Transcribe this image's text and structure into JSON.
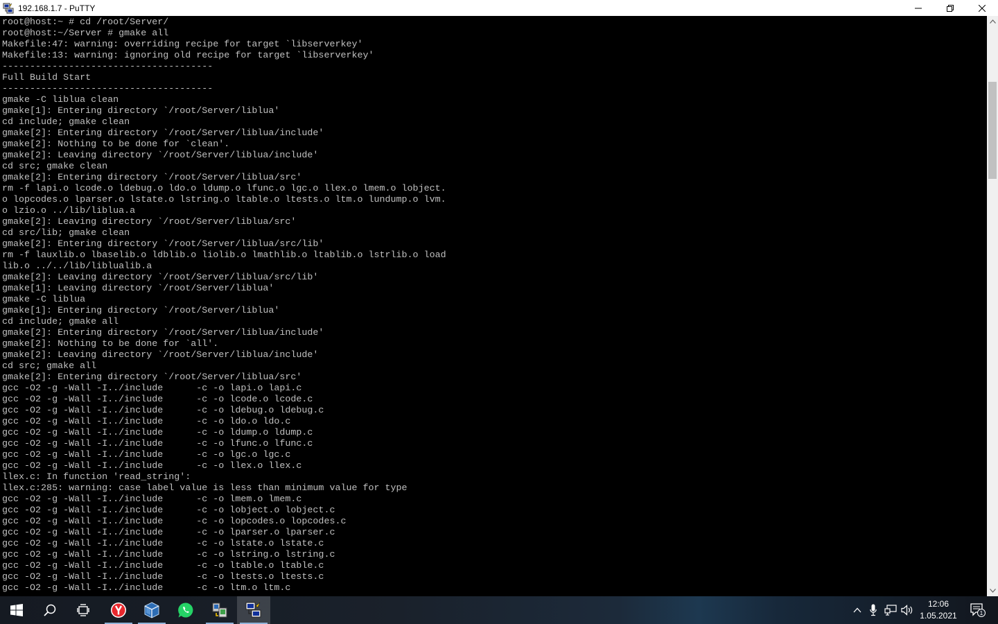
{
  "window": {
    "title": "192.168.1.7 - PuTTY",
    "controls": [
      "minimize-icon",
      "restore-icon",
      "close-icon"
    ]
  },
  "terminal": {
    "lines": [
      "root@host:~ # cd /root/Server/",
      "root@host:~/Server # gmake all",
      "Makefile:47: warning: overriding recipe for target `libserverkey'",
      "Makefile:13: warning: ignoring old recipe for target `libserverkey'",
      "--------------------------------------",
      "Full Build Start",
      "--------------------------------------",
      "gmake -C liblua clean",
      "gmake[1]: Entering directory `/root/Server/liblua'",
      "cd include; gmake clean",
      "gmake[2]: Entering directory `/root/Server/liblua/include'",
      "gmake[2]: Nothing to be done for `clean'.",
      "gmake[2]: Leaving directory `/root/Server/liblua/include'",
      "cd src; gmake clean",
      "gmake[2]: Entering directory `/root/Server/liblua/src'",
      "rm -f lapi.o lcode.o ldebug.o ldo.o ldump.o lfunc.o lgc.o llex.o lmem.o lobject.",
      "o lopcodes.o lparser.o lstate.o lstring.o ltable.o ltests.o ltm.o lundump.o lvm.",
      "o lzio.o ../lib/liblua.a",
      "gmake[2]: Leaving directory `/root/Server/liblua/src'",
      "cd src/lib; gmake clean",
      "gmake[2]: Entering directory `/root/Server/liblua/src/lib'",
      "rm -f lauxlib.o lbaselib.o ldblib.o liolib.o lmathlib.o ltablib.o lstrlib.o load",
      "lib.o ../../lib/liblualib.a",
      "gmake[2]: Leaving directory `/root/Server/liblua/src/lib'",
      "gmake[1]: Leaving directory `/root/Server/liblua'",
      "gmake -C liblua",
      "gmake[1]: Entering directory `/root/Server/liblua'",
      "cd include; gmake all",
      "gmake[2]: Entering directory `/root/Server/liblua/include'",
      "gmake[2]: Nothing to be done for `all'.",
      "gmake[2]: Leaving directory `/root/Server/liblua/include'",
      "cd src; gmake all",
      "gmake[2]: Entering directory `/root/Server/liblua/src'",
      "gcc -O2 -g -Wall -I../include      -c -o lapi.o lapi.c",
      "gcc -O2 -g -Wall -I../include      -c -o lcode.o lcode.c",
      "gcc -O2 -g -Wall -I../include      -c -o ldebug.o ldebug.c",
      "gcc -O2 -g -Wall -I../include      -c -o ldo.o ldo.c",
      "gcc -O2 -g -Wall -I../include      -c -o ldump.o ldump.c",
      "gcc -O2 -g -Wall -I../include      -c -o lfunc.o lfunc.c",
      "gcc -O2 -g -Wall -I../include      -c -o lgc.o lgc.c",
      "gcc -O2 -g -Wall -I../include      -c -o llex.o llex.c",
      "llex.c: In function 'read_string':",
      "llex.c:285: warning: case label value is less than minimum value for type",
      "gcc -O2 -g -Wall -I../include      -c -o lmem.o lmem.c",
      "gcc -O2 -g -Wall -I../include      -c -o lobject.o lobject.c",
      "gcc -O2 -g -Wall -I../include      -c -o lopcodes.o lopcodes.c",
      "gcc -O2 -g -Wall -I../include      -c -o lparser.o lparser.c",
      "gcc -O2 -g -Wall -I../include      -c -o lstate.o lstate.c",
      "gcc -O2 -g -Wall -I../include      -c -o lstring.o lstring.c",
      "gcc -O2 -g -Wall -I../include      -c -o ltable.o ltable.c",
      "gcc -O2 -g -Wall -I../include      -c -o ltests.o ltests.c",
      "gcc -O2 -g -Wall -I../include      -c -o ltm.o ltm.c"
    ],
    "text_color": "#c0c0c0",
    "background": "#000000"
  },
  "taskbar": {
    "apps": [
      "start-icon",
      "search-icon",
      "task-view-icon",
      "yandex-browser-icon",
      "virtualbox-icon",
      "whatsapp-icon",
      "file-transfer-icon",
      "putty-icon"
    ],
    "active_app": "putty-icon",
    "tray": [
      "show-hidden-icons-chevron",
      "microphone-icon",
      "network-icon",
      "volume-icon"
    ],
    "clock": {
      "time": "12:06",
      "date": "1.05.2021"
    },
    "notification_count": "1"
  }
}
